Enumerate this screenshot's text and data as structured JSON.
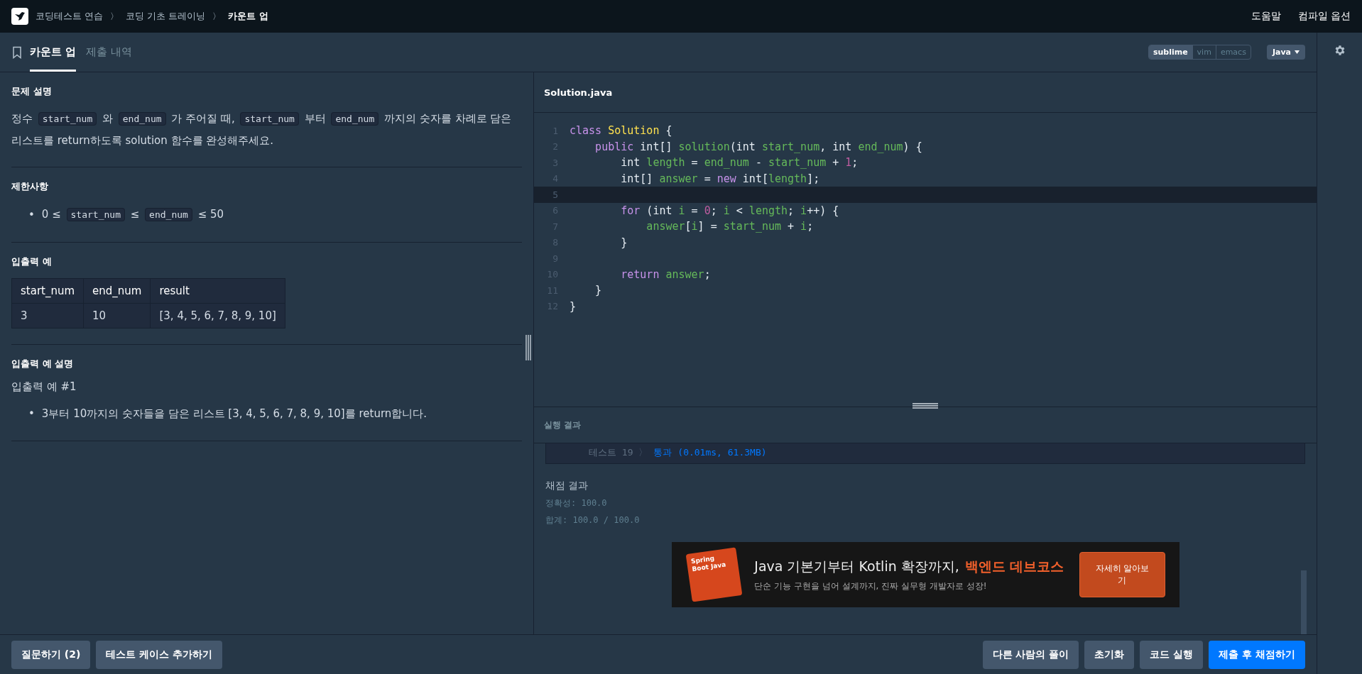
{
  "breadcrumb": [
    {
      "label": "코딩테스트 연습",
      "current": false
    },
    {
      "label": "코딩 기초 트레이닝",
      "current": false
    },
    {
      "label": "카운트 업",
      "current": true
    }
  ],
  "separator": "〉",
  "nav_links": [
    "도움말",
    "컴파일 옵션"
  ],
  "tabs": [
    {
      "label": "카운트 업",
      "selected": true
    },
    {
      "label": "제출 내역",
      "selected": false
    }
  ],
  "editor_modes": [
    {
      "label": "sublime",
      "selected": true
    },
    {
      "label": "vim",
      "selected": false
    },
    {
      "label": "emacs",
      "selected": false
    }
  ],
  "language": "Java",
  "problem": {
    "sections": [
      {
        "kind": "paragraph",
        "title": "문제 설명",
        "segments": [
          {
            "kind": "text",
            "text": "정수 "
          },
          {
            "kind": "code",
            "text": "start_num"
          },
          {
            "kind": "text",
            "text": " 와 "
          },
          {
            "kind": "code",
            "text": "end_num"
          },
          {
            "kind": "text",
            "text": " 가 주어질 때, "
          },
          {
            "kind": "code",
            "text": "start_num"
          },
          {
            "kind": "text",
            "text": " 부터 "
          },
          {
            "kind": "code",
            "text": "end_num"
          },
          {
            "kind": "text",
            "text": " 까지의 숫자를 차례로 담은 리스트를 return하도록 solution 함수를 완성해주세요."
          }
        ]
      },
      {
        "kind": "bullets",
        "title": "제한사항",
        "items": [
          {
            "bullet": "•",
            "segments": [
              {
                "kind": "text",
                "text": "0 ≤ "
              },
              {
                "kind": "code",
                "text": "start_num"
              },
              {
                "kind": "text",
                "text": " ≤ "
              },
              {
                "kind": "code",
                "text": "end_num"
              },
              {
                "kind": "text",
                "text": " ≤ 50"
              }
            ]
          }
        ]
      },
      {
        "kind": "table",
        "title": "입출력 예",
        "columns": [
          "start_num",
          "end_num",
          "result"
        ],
        "rows": [
          [
            "3",
            "10",
            "[3, 4, 5, 6, 7, 8, 9, 10]"
          ]
        ]
      },
      {
        "kind": "explanation",
        "title": "입출력 예 설명",
        "subtitle": "입출력 예 #1",
        "items": [
          {
            "bullet": "•",
            "segments": [
              {
                "kind": "text",
                "text": "3부터 10까지의 숫자들을 담은 리스트 [3, 4, 5, 6, 7, 8, 9, 10]를 return합니다."
              }
            ]
          }
        ]
      }
    ]
  },
  "editor": {
    "filename": "Solution.java",
    "lines": [
      {
        "number": "1",
        "current": false,
        "tokens": [
          {
            "kind": "keyword",
            "text": "class "
          },
          {
            "kind": "class",
            "text": "Solution"
          },
          {
            "kind": "plain",
            "text": " {"
          }
        ]
      },
      {
        "number": "2",
        "current": false,
        "tokens": [
          {
            "kind": "keyword",
            "text": "public"
          },
          {
            "kind": "plain",
            "text": " int[] "
          },
          {
            "kind": "name",
            "text": "solution"
          },
          {
            "kind": "plain",
            "text": "(int "
          },
          {
            "kind": "name",
            "text": "start_num"
          },
          {
            "kind": "plain",
            "text": ", int "
          },
          {
            "kind": "name",
            "text": "end_num"
          },
          {
            "kind": "plain",
            "text": ") {"
          }
        ]
      },
      {
        "number": "3",
        "current": false,
        "tokens": [
          {
            "kind": "plain",
            "text": "int "
          },
          {
            "kind": "name",
            "text": "length"
          },
          {
            "kind": "plain",
            "text": " = "
          },
          {
            "kind": "name",
            "text": "end_num"
          },
          {
            "kind": "plain",
            "text": " - "
          },
          {
            "kind": "name",
            "text": "start_num"
          },
          {
            "kind": "plain",
            "text": " + "
          },
          {
            "kind": "number",
            "text": "1"
          },
          {
            "kind": "plain",
            "text": ";"
          }
        ]
      },
      {
        "number": "4",
        "current": false,
        "tokens": [
          {
            "kind": "plain",
            "text": "int[] "
          },
          {
            "kind": "name",
            "text": "answer"
          },
          {
            "kind": "plain",
            "text": " = "
          },
          {
            "kind": "keyword",
            "text": "new"
          },
          {
            "kind": "plain",
            "text": " int["
          },
          {
            "kind": "name",
            "text": "length"
          },
          {
            "kind": "plain",
            "text": "];"
          }
        ]
      },
      {
        "number": "5",
        "current": true
      },
      {
        "number": "6",
        "current": false,
        "tokens": [
          {
            "kind": "keyword",
            "text": "for"
          },
          {
            "kind": "plain",
            "text": " (int "
          },
          {
            "kind": "name",
            "text": "i"
          },
          {
            "kind": "plain",
            "text": " = "
          },
          {
            "kind": "number",
            "text": "0"
          },
          {
            "kind": "plain",
            "text": "; "
          },
          {
            "kind": "name",
            "text": "i"
          },
          {
            "kind": "plain",
            "text": " < "
          },
          {
            "kind": "name",
            "text": "length"
          },
          {
            "kind": "plain",
            "text": "; "
          },
          {
            "kind": "name",
            "text": "i"
          },
          {
            "kind": "plain",
            "text": "++) {"
          }
        ]
      },
      {
        "number": "7",
        "current": false,
        "tokens": [
          {
            "kind": "name",
            "text": "answer"
          },
          {
            "kind": "plain",
            "text": "["
          },
          {
            "kind": "name",
            "text": "i"
          },
          {
            "kind": "plain",
            "text": "] = "
          },
          {
            "kind": "name",
            "text": "start_num"
          },
          {
            "kind": "plain",
            "text": " + "
          },
          {
            "kind": "name",
            "text": "i"
          },
          {
            "kind": "plain",
            "text": ";"
          }
        ]
      },
      {
        "number": "8",
        "current": false,
        "tokens": [
          {
            "kind": "plain",
            "text": "}"
          }
        ]
      },
      {
        "number": "9",
        "current": false
      },
      {
        "number": "10",
        "current": false,
        "tokens": [
          {
            "kind": "keyword",
            "text": "return "
          },
          {
            "kind": "name",
            "text": "answer"
          },
          {
            "kind": "plain",
            "text": ";"
          }
        ]
      },
      {
        "number": "11",
        "current": false,
        "tokens": [
          {
            "kind": "plain",
            "text": "}"
          }
        ]
      },
      {
        "number": "12",
        "current": false,
        "tokens": [
          {
            "kind": "plain",
            "text": "}"
          }
        ]
      }
    ]
  },
  "results": {
    "title": "실행 결과",
    "tests": [
      {
        "label": "테스트 19",
        "arrow": "〉",
        "result": "통과 (0.01ms, 61.3MB)"
      }
    ],
    "grading": {
      "title": "채점 결과",
      "lines": [
        "정확성: 100.0",
        "합계: 100.0 / 100.0"
      ]
    }
  },
  "banner": {
    "book_label": "Spring Boot Java",
    "headline": "Java 기본기부터 Kotlin 확장까지,",
    "highlight": "백엔드 데브코스",
    "subline": "단순 기능 구현을 넘어 설계까지, 진짜 실무형 개발자로 성장!",
    "button": "자세히 알아보기"
  },
  "footer": {
    "left_buttons": [
      {
        "label": "질문하기 (2)",
        "kind": "default"
      },
      {
        "label": "테스트 케이스 추가하기",
        "kind": "default"
      }
    ],
    "right_buttons": [
      {
        "label": "다른 사람의 풀이",
        "kind": "default"
      },
      {
        "label": "초기화",
        "kind": "default"
      },
      {
        "label": "코드 실행",
        "kind": "default"
      },
      {
        "label": "제출 후 채점하기",
        "kind": "primary"
      }
    ]
  }
}
